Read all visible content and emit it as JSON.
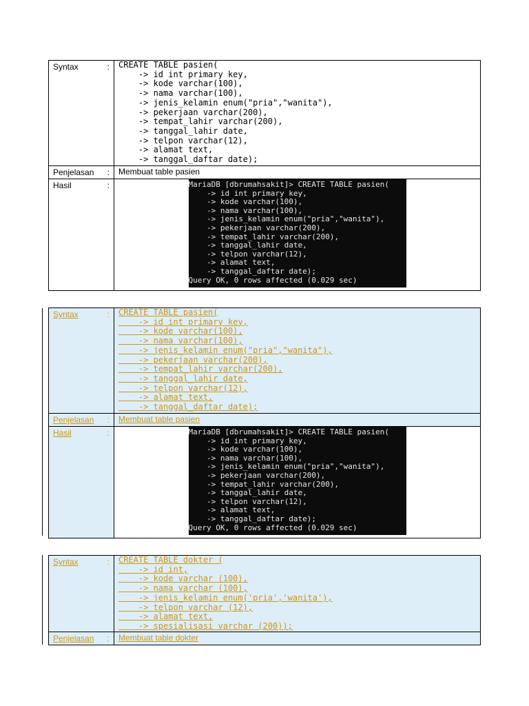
{
  "labels": {
    "syntax": "Syntax",
    "penjelasan": "Penjelasan",
    "hasil": "Hasil",
    "colon": ":"
  },
  "table1": {
    "code": "CREATE TABLE pasien(\n    -> id int primary key,\n    -> kode varchar(100),\n    -> nama varchar(100),\n    -> jenis_kelamin enum(\"pria\",\"wanita\"),\n    -> pekerjaan varchar(200),\n    -> tempat_lahir varchar(200),\n    -> tanggal_lahir date,\n    -> telpon varchar(12),\n    -> alamat text,\n    -> tanggal_daftar date);",
    "penjelasan": "Membuat table pasien",
    "terminal": "MariaDB [dbrumahsakit]> CREATE TABLE pasien(\n    -> id int primary key,\n    -> kode varchar(100),\n    -> nama varchar(100),\n    -> jenis_kelamin enum(\"pria\",\"wanita\"),\n    -> pekerjaan varchar(200),\n    -> tempat_lahir varchar(200),\n    -> tanggal_lahir date,\n    -> telpon varchar(12),\n    -> alamat text,\n    -> tanggal_daftar date);\nQuery OK, 0 rows affected (0.029 sec)"
  },
  "table2": {
    "code": "CREATE TABLE pasien(\n    -> id int primary key,\n    -> kode varchar(100),\n    -> nama varchar(100),\n    -> jenis_kelamin enum(\"pria\",\"wanita\"),\n    -> pekerjaan varchar(200),\n    -> tempat_lahir varchar(200),\n    -> tanggal_lahir date,\n    -> telpon varchar(12),\n    -> alamat text,\n    -> tanggal_daftar date);",
    "penjelasan": "Membuat table pasien",
    "terminal": "MariaDB [dbrumahsakit]> CREATE TABLE pasien(\n    -> id int primary key,\n    -> kode varchar(100),\n    -> nama varchar(100),\n    -> jenis_kelamin enum(\"pria\",\"wanita\"),\n    -> pekerjaan varchar(200),\n    -> tempat_lahir varchar(200),\n    -> tanggal_lahir date,\n    -> telpon varchar(12),\n    -> alamat text,\n    -> tanggal_daftar date);\nQuery OK, 0 rows affected (0.029 sec)"
  },
  "table3": {
    "code": "CREATE TABLE dokter (\n    -> id int,\n    -> kode varchar (100),\n    -> nama varchar (100),\n    -> jenis_kelamin enum('pria','wanita'),\n    -> telpon varchar (12),\n    -> alamat text,\n    -> spesialisasi varchar (200));",
    "penjelasan": "Membuat table dokter"
  },
  "colors": {
    "tracked_background": "#deeef8",
    "tracked_text": "#c8961e",
    "terminal_background": "#0c0c0c",
    "terminal_text": "#e6e6e6"
  }
}
